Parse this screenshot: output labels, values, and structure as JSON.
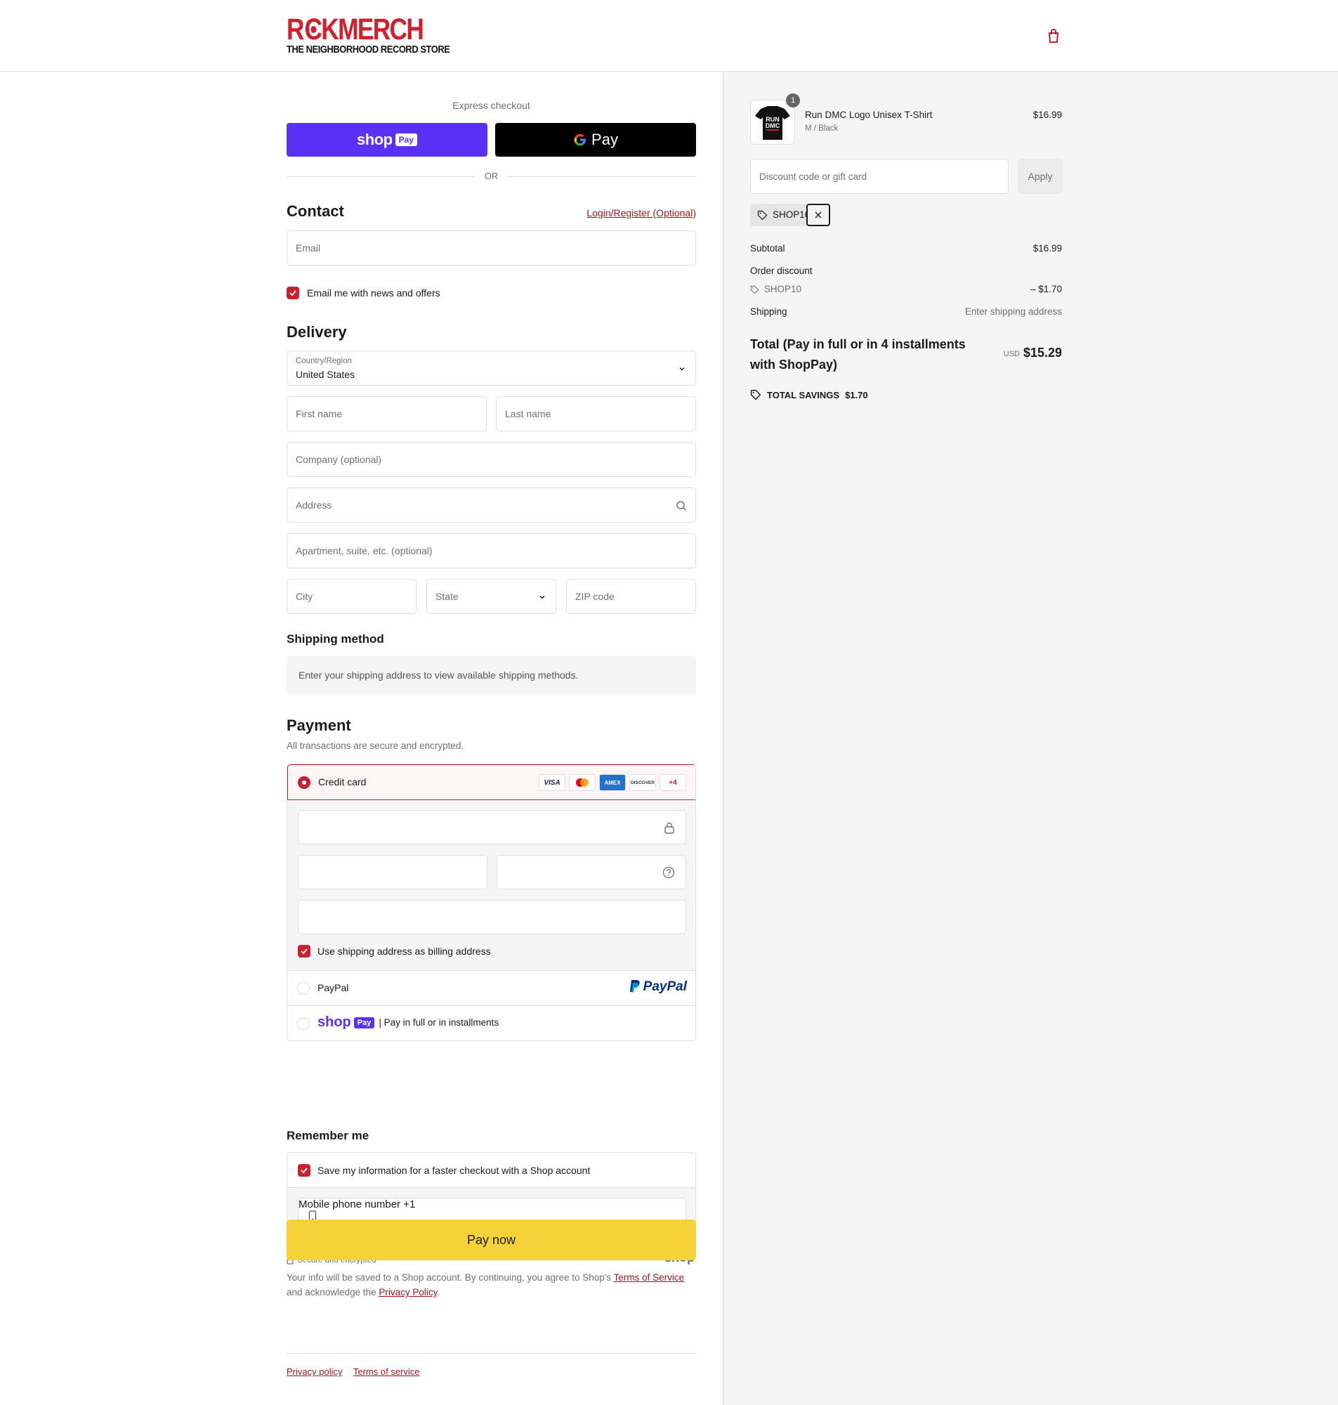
{
  "header": {
    "logo_main": "ROCKMERCH",
    "logo_sub": "THE NEIGHBORHOOD RECORD STORE",
    "cart_icon": "shopping-bag-icon"
  },
  "express": {
    "label": "Express checkout",
    "shoppay_word": "shop",
    "shoppay_badge": "Pay",
    "gpay_label": "Pay",
    "or_label": "OR"
  },
  "contact": {
    "title": "Contact",
    "login_link": "Login/Register (Optional)",
    "email_placeholder": "Email",
    "news_label": "Email me with news and offers",
    "news_checked": true
  },
  "delivery": {
    "title": "Delivery",
    "country_label": "Country/Region",
    "country_value": "United States",
    "first_name_placeholder": "First name",
    "last_name_placeholder": "Last name",
    "company_placeholder": "Company (optional)",
    "address_placeholder": "Address",
    "apartment_placeholder": "Apartment, suite, etc. (optional)",
    "city_placeholder": "City",
    "state_placeholder": "State",
    "zip_placeholder": "ZIP code"
  },
  "shipping_method": {
    "title": "Shipping method",
    "note": "Enter your shipping address to view available shipping methods."
  },
  "payment": {
    "title": "Payment",
    "subtitle": "All transactions are secure and encrypted.",
    "credit_card_label": "Credit card",
    "card_logos": [
      "VISA",
      "MC",
      "AMEX",
      "DISCOVER"
    ],
    "more_cards": "+4",
    "billing_label": "Use shipping address as billing address",
    "paypal_label": "PayPal",
    "paypal_logo": "PayPal",
    "shoppay_word": "shop",
    "shoppay_badge": "Pay",
    "shoppay_label": "| Pay in full or in installments"
  },
  "remember": {
    "title": "Remember me",
    "save_label": "Save my information for a faster checkout with a Shop account",
    "phone_label": "Mobile phone number",
    "phone_value": "+1",
    "secure_label": "Secure and encrypted",
    "shop_logo": "shop"
  },
  "paynow": {
    "label": "Pay now"
  },
  "fine_print": {
    "text_before": "Your info will be saved to a Shop account. By continuing, you agree to Shop's ",
    "terms_link": "Terms of Service",
    "text_mid": " and acknowledge the ",
    "privacy_link": "Privacy Policy",
    "text_after": "."
  },
  "footer": {
    "privacy": "Privacy policy",
    "terms": "Terms of service"
  },
  "summary": {
    "product": {
      "title": "Run DMC Logo Unisex T-Shirt",
      "variant": "M / Black",
      "price": "$16.99",
      "quantity": "1",
      "shirt_text_1": "RUN",
      "shirt_text_2": "DMC"
    },
    "discount_placeholder": "Discount code or gift card",
    "apply_label": "Apply",
    "applied_code": "SHOP10",
    "subtotal_label": "Subtotal",
    "subtotal_value": "$16.99",
    "order_discount_label": "Order discount",
    "discount_code": "SHOP10",
    "discount_value": "– $1.70",
    "shipping_label": "Shipping",
    "shipping_value": "Enter shipping address",
    "total_label": "Total (Pay in full or in 4 installments with ShopPay)",
    "total_currency": "USD",
    "total_value": "$15.29",
    "savings_label": "TOTAL SAVINGS",
    "savings_value": "$1.70"
  },
  "colors": {
    "brand_red": "#c8202e",
    "shoppay_purple": "#5a31f4",
    "paynow_yellow": "#f5d338",
    "link_red": "#a31622"
  }
}
